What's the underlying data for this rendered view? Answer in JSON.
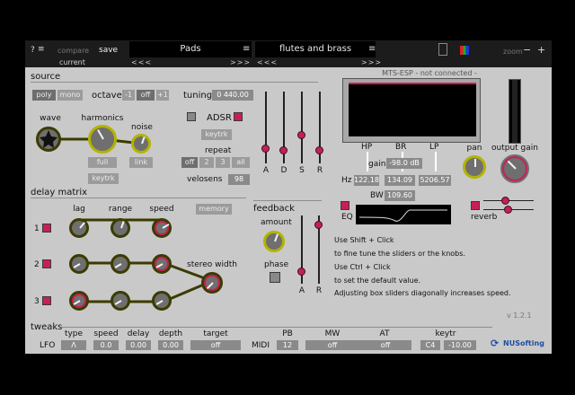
{
  "topbar": {
    "help": "?",
    "compare": "compare",
    "save": "save",
    "current": "current",
    "preset_left": "Pads",
    "preset_right": "flutes and brass",
    "nav_prev": "<<<",
    "nav_next": ">>>",
    "zoom": "zoom",
    "zoom_minus": "−",
    "zoom_plus": "+"
  },
  "source": {
    "title": "source",
    "poly": "poly",
    "mono": "mono",
    "octave_label": "octave",
    "octave_opts": [
      "-1",
      "off",
      "+1"
    ],
    "tuning_label": "tuning",
    "tuning_value": "0 440.00",
    "wave": "wave",
    "harmonics": "harmonics",
    "noise": "noise",
    "full": "full",
    "link": "link",
    "keytrk": "keytrk",
    "adsr": "ADSR",
    "adsr_keytrk": "keytrk",
    "repeat": "repeat",
    "repeat_opts": [
      "off",
      "2",
      "3",
      "all"
    ],
    "velosens": "velosens",
    "velosens_value": "98",
    "adsr_labels": [
      "A",
      "D",
      "S",
      "R"
    ]
  },
  "mts": {
    "status": "MTS-ESP - not connected -"
  },
  "filter": {
    "hp": "HP",
    "br": "BR",
    "lp": "LP",
    "gain_label": "gain",
    "gain_value": "-98.0 dB",
    "hz": "Hz",
    "hp_value": "122.18",
    "br_value": "134.09",
    "lp_value": "5206.57",
    "bw_label": "BW",
    "bw_value": "109.60",
    "eq": "EQ"
  },
  "output": {
    "pan": "pan",
    "output_gain": "output gain",
    "reverb": "reverb"
  },
  "delay": {
    "title": "delay matrix",
    "lag": "lag",
    "range": "range",
    "speed": "speed",
    "memory": "memory",
    "rows": [
      "1",
      "2",
      "3"
    ],
    "stereo_width": "stereo width"
  },
  "feedback": {
    "title": "feedback",
    "amount": "amount",
    "phase": "phase",
    "a": "A",
    "r": "R"
  },
  "help": {
    "line1": "Use Shift + Click",
    "line2": "to fine tune the sliders or the knobs.",
    "line3": "Use Ctrl + Click",
    "line4": "to set the default value.",
    "line5": "Adjusting box sliders diagonally increases speed."
  },
  "version": "v 1.2.1",
  "brand": "NUSofting",
  "tweaks": {
    "title": "tweaks",
    "lfo": "LFO",
    "lfo_headers": [
      "type",
      "speed",
      "delay",
      "depth",
      "target"
    ],
    "lfo_values": [
      "Λ",
      "0.0",
      "0.00",
      "0.00",
      "off"
    ],
    "midi": "MIDI",
    "midi_headers": [
      "PB",
      "MW",
      "AT",
      "keytr"
    ],
    "midi_values": [
      "12",
      "off",
      "off",
      "C4",
      "-10.00"
    ]
  },
  "colors": {
    "panel": "#c9c9c9",
    "accent_knob_ring": "#b3b300",
    "led": "#c81e5a",
    "topbar": "#1c1c1c"
  }
}
